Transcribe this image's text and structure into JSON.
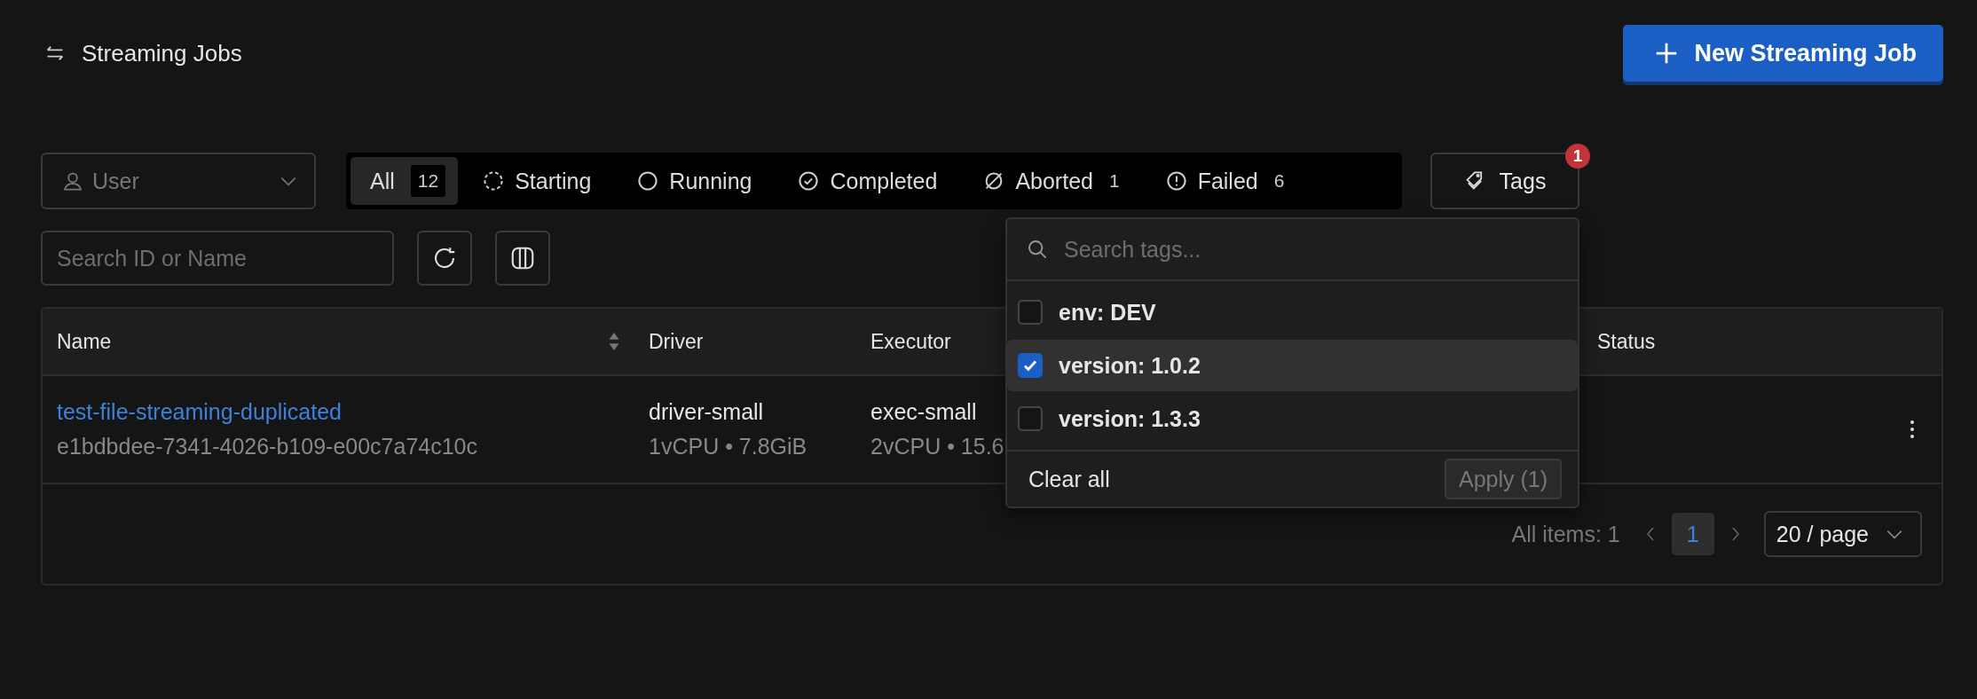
{
  "header": {
    "title": "Streaming Jobs",
    "new_button": "New Streaming Job"
  },
  "filters": {
    "user_select": {
      "placeholder": "User"
    },
    "statuses": [
      {
        "kind": "all",
        "label": "All",
        "count": "12",
        "selected": true
      },
      {
        "kind": "starting",
        "label": "Starting",
        "selected": false
      },
      {
        "kind": "running",
        "label": "Running",
        "selected": false
      },
      {
        "kind": "completed",
        "label": "Completed",
        "selected": false
      },
      {
        "kind": "aborted",
        "label": "Aborted",
        "count": "1",
        "selected": false
      },
      {
        "kind": "failed",
        "label": "Failed",
        "count": "6",
        "selected": false
      }
    ],
    "tags_button": {
      "label": "Tags",
      "badge": "1"
    },
    "search": {
      "placeholder": "Search ID or Name"
    }
  },
  "tags_dropdown": {
    "search": {
      "placeholder": "Search tags..."
    },
    "items": [
      {
        "label": "env: DEV",
        "checked": false,
        "selected": false
      },
      {
        "label": "version: 1.0.2",
        "checked": true,
        "selected": true
      },
      {
        "label": "version: 1.3.3",
        "checked": false,
        "selected": false
      }
    ],
    "clear_button": "Clear all",
    "apply_button": "Apply (1)"
  },
  "table": {
    "columns": [
      {
        "label": "Name",
        "sortable": true
      },
      {
        "label": "Driver",
        "sortable": false
      },
      {
        "label": "Executor"
      },
      {
        "label": "Status",
        "sortable": false
      }
    ],
    "rows": [
      {
        "name": "test-file-streaming-duplicated",
        "id": "e1bdbdee-7341-4026-b109-e00c7a74c10c",
        "driver": "driver-small",
        "driver_spec": "1vCPU • 7.8GiB",
        "executor": "exec-small",
        "executor_spec": "2vCPU • 15.6"
      }
    ]
  },
  "pagination": {
    "total": "All items: 1",
    "pages": [
      {
        "label": "1",
        "selected": true
      }
    ],
    "page_size": "20 / page"
  }
}
